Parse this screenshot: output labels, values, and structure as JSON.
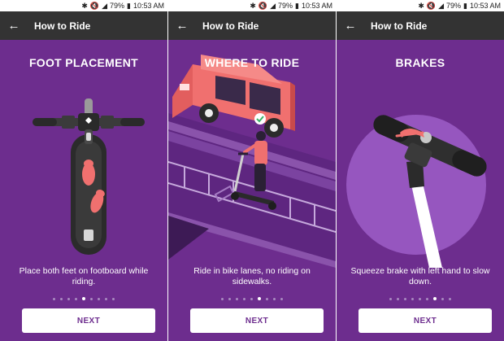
{
  "status_bar": {
    "battery": "79%",
    "time": "10:53 AM"
  },
  "screens": [
    {
      "app_title": "How to Ride",
      "heading": "FOOT PLACEMENT",
      "caption": "Place both feet on footboard while riding.",
      "next_label": "NEXT",
      "active_step": 4
    },
    {
      "app_title": "How to Ride",
      "heading": "WHERE TO RIDE",
      "caption": "Ride in bike lanes, no riding on sidewalks.",
      "next_label": "NEXT",
      "active_step": 5
    },
    {
      "app_title": "How to Ride",
      "heading": "BRAKES",
      "caption": "Squeeze brake with left hand to slow down.",
      "next_label": "NEXT",
      "active_step": 6
    }
  ],
  "dot_count": 9,
  "colors": {
    "brand_purple": "#6d2d8e",
    "accent_coral": "#f0706f",
    "appbar": "#333333"
  },
  "icons": {
    "back": "back-arrow-icon",
    "bluetooth": "bluetooth-off-icon",
    "mute": "mute-icon",
    "signal": "signal-icon",
    "battery": "battery-icon",
    "check": "check-icon"
  }
}
